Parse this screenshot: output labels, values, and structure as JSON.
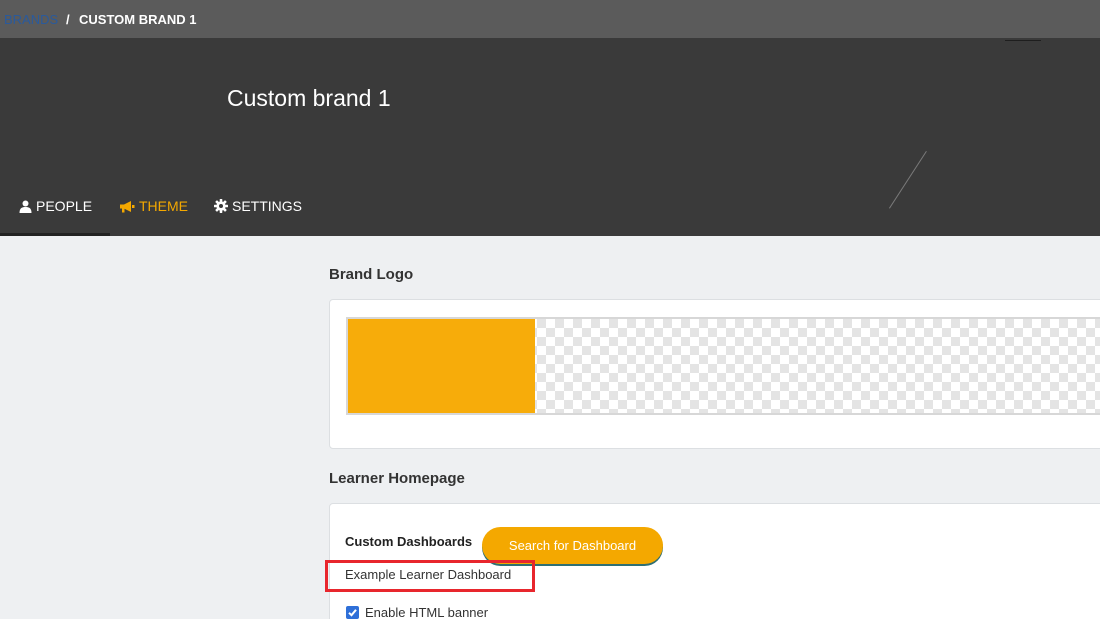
{
  "breadcrumb": {
    "root": "BRANDS",
    "separator": "/",
    "current": "CUSTOM BRAND 1"
  },
  "header": {
    "title": "Custom brand 1"
  },
  "tabs": [
    {
      "label": "PEOPLE",
      "icon": "person-icon",
      "active": false
    },
    {
      "label": "THEME",
      "icon": "megaphone-icon",
      "active": true
    },
    {
      "label": "SETTINGS",
      "icon": "gear-icon",
      "active": false
    }
  ],
  "brand_logo": {
    "title": "Brand Logo",
    "swatch_color": "#f7ac0a"
  },
  "learner_homepage": {
    "title": "Learner Homepage",
    "custom_dashboards_label": "Custom Dashboards",
    "search_button": "Search for Dashboard",
    "dashboard_name": "Example Learner Dashboard",
    "enable_html_banner": {
      "label": "Enable HTML banner",
      "checked": true
    }
  },
  "colors": {
    "accent": "#f4a800",
    "highlight": "#e8262d",
    "checkbox": "#2e6fd8"
  }
}
